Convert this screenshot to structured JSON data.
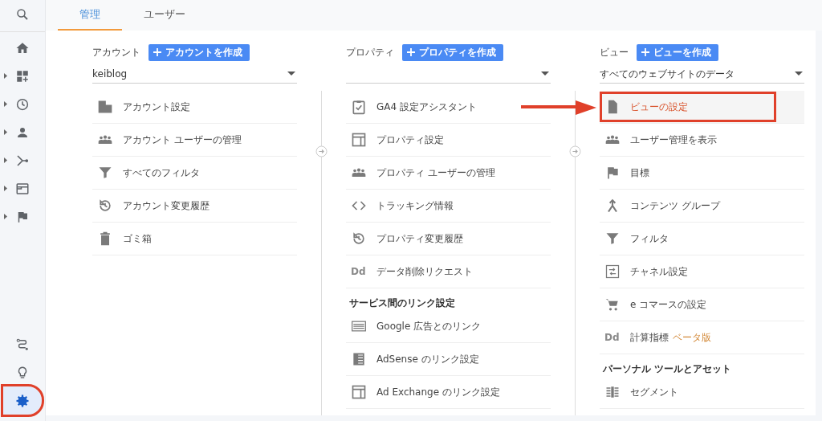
{
  "sidebar": {
    "top": [
      {
        "expandable": false,
        "selected": false,
        "highlighted": false
      },
      {
        "expandable": false,
        "selected": false,
        "highlighted": false
      },
      {
        "expandable": true,
        "selected": false,
        "highlighted": false
      },
      {
        "expandable": true,
        "selected": false,
        "highlighted": false
      },
      {
        "expandable": true,
        "selected": false,
        "highlighted": false
      },
      {
        "expandable": true,
        "selected": false,
        "highlighted": false
      },
      {
        "expandable": true,
        "selected": false,
        "highlighted": false
      },
      {
        "expandable": true,
        "selected": false,
        "highlighted": false
      }
    ],
    "bottom": [
      {
        "expandable": false,
        "selected": false,
        "highlighted": false
      },
      {
        "expandable": false,
        "selected": false,
        "highlighted": false
      },
      {
        "expandable": false,
        "selected": true,
        "highlighted": true
      }
    ]
  },
  "tabs": [
    {
      "label": "管理",
      "selected": true
    },
    {
      "label": "ユーザー",
      "selected": false
    }
  ],
  "columns": [
    {
      "title": "アカウント",
      "create_button": "アカウントを作成",
      "dropdown": {
        "value": "keiblog"
      },
      "items": [
        {
          "kind": "link",
          "label": "アカウント設定",
          "highlighted": false
        },
        {
          "kind": "link",
          "label": "アカウント ユーザーの管理",
          "highlighted": false
        },
        {
          "kind": "link",
          "label": "すべてのフィルタ",
          "highlighted": false
        },
        {
          "kind": "link",
          "label": "アカウント変更履歴",
          "highlighted": false
        },
        {
          "kind": "link",
          "label": "ゴミ箱",
          "highlighted": false
        }
      ]
    },
    {
      "title": "プロパティ",
      "create_button": "プロパティを作成",
      "items": [
        {
          "kind": "link",
          "label": "GA4 設定アシスタント",
          "highlighted": false
        },
        {
          "kind": "link",
          "label": "プロパティ設定",
          "highlighted": false
        },
        {
          "kind": "link",
          "label": "プロパティ ユーザーの管理",
          "highlighted": false
        },
        {
          "kind": "link",
          "label": "トラッキング情報",
          "highlighted": false
        },
        {
          "kind": "link",
          "label": "プロパティ変更履歴",
          "highlighted": false
        },
        {
          "kind": "link",
          "icon_text": "Dd",
          "label": "データ削除リクエスト",
          "highlighted": false
        },
        {
          "kind": "header",
          "label": "サービス間のリンク設定",
          "highlighted": false
        },
        {
          "kind": "link",
          "label": "Google 広告とのリンク",
          "highlighted": false
        },
        {
          "kind": "link",
          "label": "AdSense のリンク設定",
          "highlighted": false
        },
        {
          "kind": "link",
          "label": "Ad Exchange のリンク設定",
          "highlighted": false
        }
      ]
    },
    {
      "title": "ビュー",
      "create_button": "ビューを作成",
      "dropdown": {
        "value": "すべてのウェブサイトのデータ"
      },
      "items": [
        {
          "kind": "link",
          "label": "ビューの設定",
          "highlighted": true
        },
        {
          "kind": "link",
          "label": "ユーザー管理を表示",
          "highlighted": false
        },
        {
          "kind": "link",
          "label": "目標",
          "highlighted": false
        },
        {
          "kind": "link",
          "label": "コンテンツ グループ",
          "highlighted": false
        },
        {
          "kind": "link",
          "label": "フィルタ",
          "highlighted": false
        },
        {
          "kind": "link",
          "label": "チャネル設定",
          "highlighted": false
        },
        {
          "kind": "link",
          "label": "e コマースの設定",
          "highlighted": false
        },
        {
          "kind": "link",
          "icon_text": "Dd",
          "label": "計算指標",
          "badge": "ベータ版",
          "highlighted": false
        },
        {
          "kind": "header",
          "label": "パーソナル ツールとアセット",
          "highlighted": false
        },
        {
          "kind": "link",
          "label": "セグメント",
          "highlighted": false
        }
      ]
    }
  ]
}
